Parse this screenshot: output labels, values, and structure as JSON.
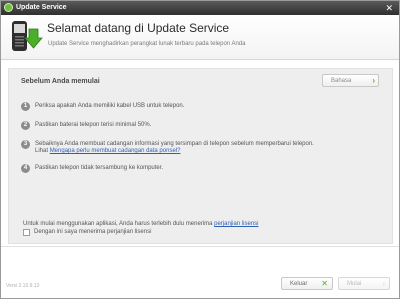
{
  "titlebar": {
    "title": "Update Service",
    "close_glyph": "✕"
  },
  "header": {
    "title": "Selamat datang di Update Service",
    "subtitle": "Update Service menghadirkan perangkat lunak terbaru pada telepon Anda"
  },
  "panel": {
    "title": "Sebelum Anda memulai",
    "language_button": "Bahasa",
    "steps": [
      {
        "num": "1",
        "text": "Periksa apakah Anda memiliki kabel USB untuk telepon."
      },
      {
        "num": "2",
        "text": "Pastikan baterai telepon terisi minimal 50%."
      },
      {
        "num": "3",
        "text": "Sebaiknya Anda membuat cadangan informasi yang tersimpan di telepon sebelum memperbarui telepon.",
        "text_b": "Lihat",
        "link": "Mengapa perlu membuat cadangan data ponsel?"
      },
      {
        "num": "4",
        "text": "Pastikan telepon tidak tersambung ke komputer."
      }
    ]
  },
  "consent": {
    "text": "Untuk mulai menggunakan aplikasi, Anda harus terlebih dulu menerima",
    "link": "perjanjian lisensi",
    "checkbox_label": "Dengan ini saya menerima perjanjian lisensi",
    "checked": false
  },
  "footer": {
    "version": "Versi 2.10.9.13",
    "exit_label": "Keluar",
    "next_label": "Mulai"
  },
  "colors": {
    "accent": "#58a92e",
    "link": "#2f5fb3",
    "titlebar": "#3a3a3a"
  }
}
